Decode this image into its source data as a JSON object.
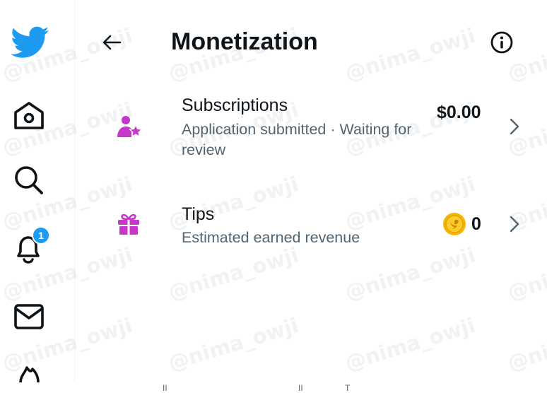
{
  "header": {
    "title": "Monetization",
    "back_icon": "arrow-left-icon",
    "info_icon": "info-circle-icon"
  },
  "sidebar": {
    "items": [
      {
        "name": "twitter-logo",
        "icon": "twitter-bird-icon"
      },
      {
        "name": "home",
        "icon": "home-icon"
      },
      {
        "name": "explore",
        "icon": "search-icon"
      },
      {
        "name": "notifications",
        "icon": "bell-icon",
        "badge": "1"
      },
      {
        "name": "messages",
        "icon": "mail-icon"
      },
      {
        "name": "flame",
        "icon": "flame-icon"
      }
    ]
  },
  "rows": [
    {
      "title": "Subscriptions",
      "subtitle": "Application submitted · Waiting for review",
      "amount": "$0.00",
      "icon": "person-star-icon"
    },
    {
      "title": "Tips",
      "subtitle": "Estimated earned revenue",
      "amount": "0",
      "icon": "gift-icon",
      "coin_icon": "gold-coin-icon"
    }
  ],
  "bottom_text": [
    "II",
    "II",
    "T"
  ],
  "watermark": "@nima_owji",
  "colors": {
    "brand": "#1d9bf0",
    "accent": "#c936cc",
    "text": "#0f1419",
    "secondary": "#536471",
    "coin": "#f5b800"
  }
}
